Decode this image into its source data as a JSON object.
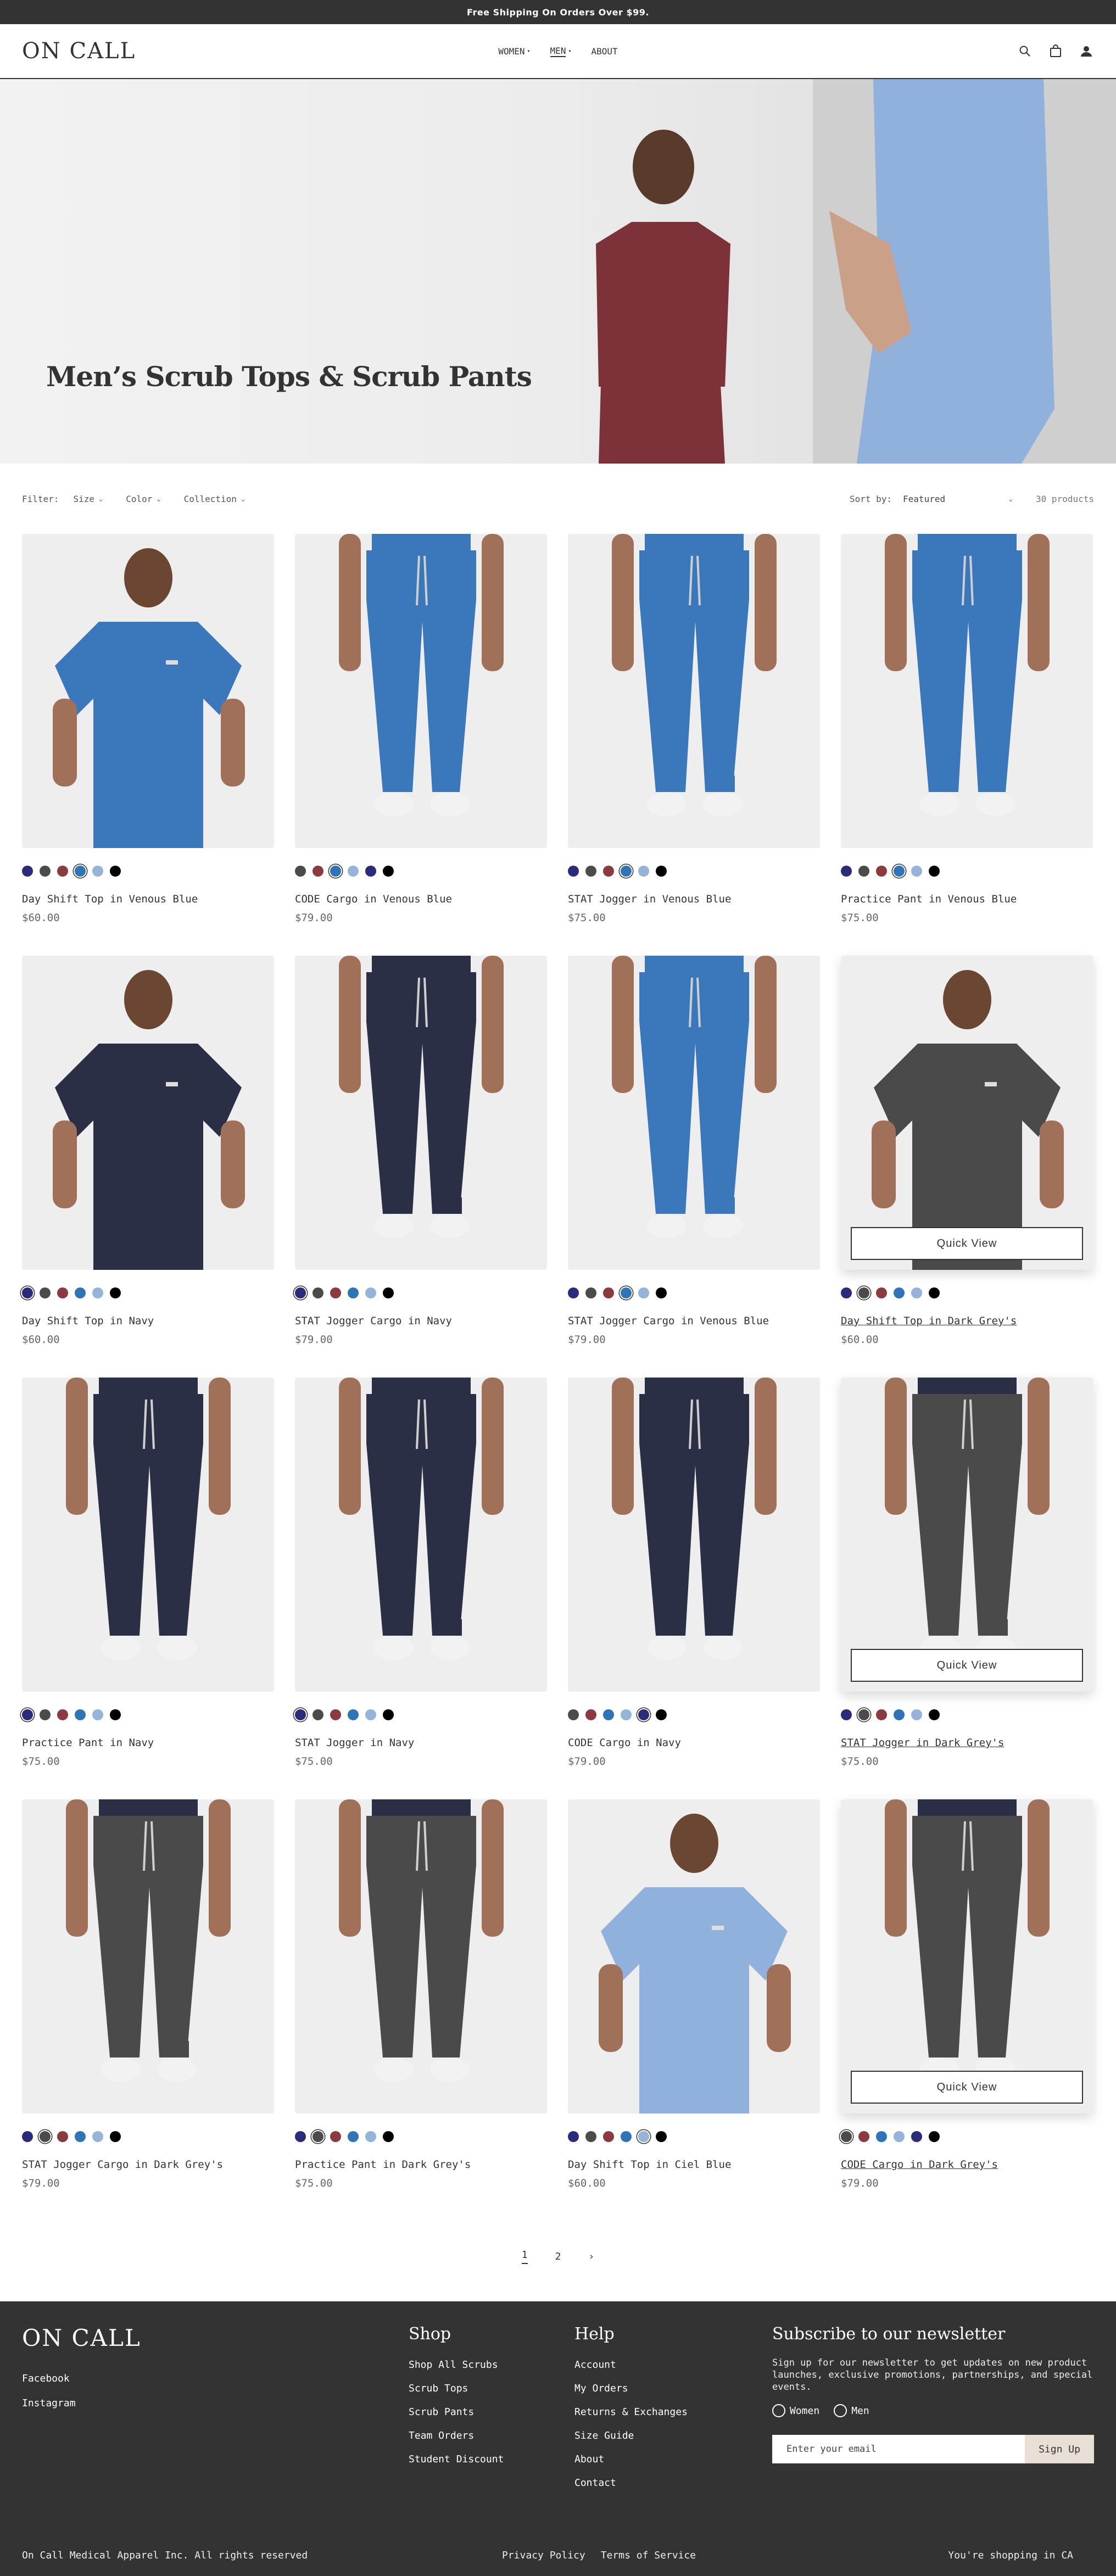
{
  "announcement": "Free Shipping On Orders Over $99.",
  "header": {
    "logo": "ON CALL",
    "nav": [
      {
        "label": "WOMEN",
        "caret": "▾",
        "active": false
      },
      {
        "label": "MEN",
        "caret": "▾",
        "active": true
      },
      {
        "label": "ABOUT",
        "caret": "",
        "active": false
      }
    ],
    "icons": [
      "search-icon",
      "bag-icon",
      "account-icon"
    ]
  },
  "hero": {
    "title": "Men’s Scrub Tops & Scrub Pants"
  },
  "filters": {
    "label": "Filter:",
    "buttons": [
      "Size",
      "Color",
      "Collection"
    ],
    "sort_label": "Sort by:",
    "sort_value": "Featured",
    "count": "30 products"
  },
  "colors": {
    "navy": "#2c2a7a",
    "grey": "#4b4b4b",
    "burgundy": "#8b3b3f",
    "blue": "#2f74b7",
    "lightblue": "#96b3d8",
    "black": "#000000",
    "image_bg": "#eeeeee",
    "footer_bg": "#333333",
    "signup_bg": "#e8dfd5"
  },
  "products": [
    {
      "name": "Day Shift Top in Venous Blue",
      "price": "$60.00",
      "swatches": [
        "navy",
        "grey",
        "burgundy",
        "blue",
        "lightblue",
        "black"
      ],
      "selected": 3,
      "hover": false,
      "figure": "top",
      "garment": "#3a78bb"
    },
    {
      "name": "CODE Cargo in Venous Blue",
      "price": "$79.00",
      "swatches": [
        "grey",
        "burgundy",
        "blue",
        "lightblue",
        "navy",
        "black"
      ],
      "selected": 2,
      "hover": false,
      "figure": "pant",
      "garment": "#3a78bb"
    },
    {
      "name": "STAT Jogger in Venous Blue",
      "price": "$75.00",
      "swatches": [
        "navy",
        "grey",
        "burgundy",
        "blue",
        "lightblue",
        "black"
      ],
      "selected": 3,
      "hover": false,
      "figure": "jogger",
      "garment": "#3a78bb"
    },
    {
      "name": "Practice Pant in Venous Blue",
      "price": "$75.00",
      "swatches": [
        "navy",
        "grey",
        "burgundy",
        "blue",
        "lightblue",
        "black"
      ],
      "selected": 3,
      "hover": false,
      "figure": "pant",
      "garment": "#3a78bb"
    },
    {
      "name": "Day Shift Top in Navy",
      "price": "$60.00",
      "swatches": [
        "navy",
        "grey",
        "burgundy",
        "blue",
        "lightblue",
        "black"
      ],
      "selected": 0,
      "hover": false,
      "figure": "top",
      "garment": "#2b2f45"
    },
    {
      "name": "STAT Jogger Cargo in Navy",
      "price": "$79.00",
      "swatches": [
        "navy",
        "grey",
        "burgundy",
        "blue",
        "lightblue",
        "black"
      ],
      "selected": 0,
      "hover": false,
      "figure": "jogger",
      "garment": "#2b2f45"
    },
    {
      "name": "STAT Jogger Cargo in Venous Blue",
      "price": "$79.00",
      "swatches": [
        "navy",
        "grey",
        "burgundy",
        "blue",
        "lightblue",
        "black"
      ],
      "selected": 3,
      "hover": false,
      "figure": "jogger",
      "garment": "#3a78bb"
    },
    {
      "name": "Day Shift Top in Dark Grey's",
      "price": "$60.00",
      "swatches": [
        "navy",
        "grey",
        "burgundy",
        "blue",
        "lightblue",
        "black"
      ],
      "selected": 1,
      "hover": true,
      "figure": "top",
      "garment": "#4a4a4a"
    },
    {
      "name": "Practice Pant in Navy",
      "price": "$75.00",
      "swatches": [
        "navy",
        "grey",
        "burgundy",
        "blue",
        "lightblue",
        "black"
      ],
      "selected": 0,
      "hover": false,
      "figure": "pant",
      "garment": "#2b2f45"
    },
    {
      "name": "STAT Jogger in Navy",
      "price": "$75.00",
      "swatches": [
        "navy",
        "grey",
        "burgundy",
        "blue",
        "lightblue",
        "black"
      ],
      "selected": 0,
      "hover": false,
      "figure": "jogger",
      "garment": "#2b2f45"
    },
    {
      "name": "CODE Cargo in Navy",
      "price": "$79.00",
      "swatches": [
        "grey",
        "burgundy",
        "blue",
        "lightblue",
        "navy",
        "black"
      ],
      "selected": 4,
      "hover": false,
      "figure": "pant",
      "garment": "#2b2f45"
    },
    {
      "name": "STAT Jogger in Dark Grey's",
      "price": "$75.00",
      "swatches": [
        "navy",
        "grey",
        "burgundy",
        "blue",
        "lightblue",
        "black"
      ],
      "selected": 1,
      "hover": true,
      "figure": "jogger",
      "garment": "#4a4a4a"
    },
    {
      "name": "STAT Jogger Cargo in Dark Grey's",
      "price": "$79.00",
      "swatches": [
        "navy",
        "grey",
        "burgundy",
        "blue",
        "lightblue",
        "black"
      ],
      "selected": 1,
      "hover": false,
      "figure": "jogger",
      "garment": "#4a4a4a"
    },
    {
      "name": "Practice Pant in Dark Grey's",
      "price": "$75.00",
      "swatches": [
        "navy",
        "grey",
        "burgundy",
        "blue",
        "lightblue",
        "black"
      ],
      "selected": 1,
      "hover": false,
      "figure": "pant",
      "garment": "#4a4a4a"
    },
    {
      "name": "Day Shift Top in Ciel Blue",
      "price": "$60.00",
      "swatches": [
        "navy",
        "grey",
        "burgundy",
        "blue",
        "lightblue",
        "black"
      ],
      "selected": 4,
      "hover": false,
      "figure": "top",
      "garment": "#8fb1dc"
    },
    {
      "name": "CODE Cargo in Dark Grey's",
      "price": "$79.00",
      "swatches": [
        "grey",
        "burgundy",
        "blue",
        "lightblue",
        "navy",
        "black"
      ],
      "selected": 0,
      "hover": true,
      "figure": "pant",
      "garment": "#4a4a4a"
    }
  ],
  "quick_view": "Quick View",
  "pagination": {
    "pages": [
      "1",
      "2"
    ],
    "current": "1",
    "next": "›"
  },
  "footer": {
    "logo": "ON CALL",
    "social": [
      "Facebook",
      "Instagram"
    ],
    "shop": {
      "title": "Shop",
      "links": [
        "Shop All Scrubs",
        "Scrub Tops",
        "Scrub Pants",
        "Team Orders",
        "Student Discount"
      ]
    },
    "help": {
      "title": "Help",
      "links": [
        "Account",
        "My Orders",
        "Returns & Exchanges",
        "Size Guide",
        "About",
        "Contact"
      ]
    },
    "newsletter": {
      "title": "Subscribe to our newsletter",
      "text": "Sign up for our newsletter to get updates on new product launches, exclusive promotions, partnerships, and special events.",
      "options": [
        "Women",
        "Men"
      ],
      "placeholder": "Enter your email",
      "button": "Sign Up"
    },
    "copyright": "On Call Medical Apparel Inc. All rights reserved",
    "legal": [
      "Privacy Policy",
      "Terms of Service"
    ],
    "region": "You're shopping in CA"
  }
}
